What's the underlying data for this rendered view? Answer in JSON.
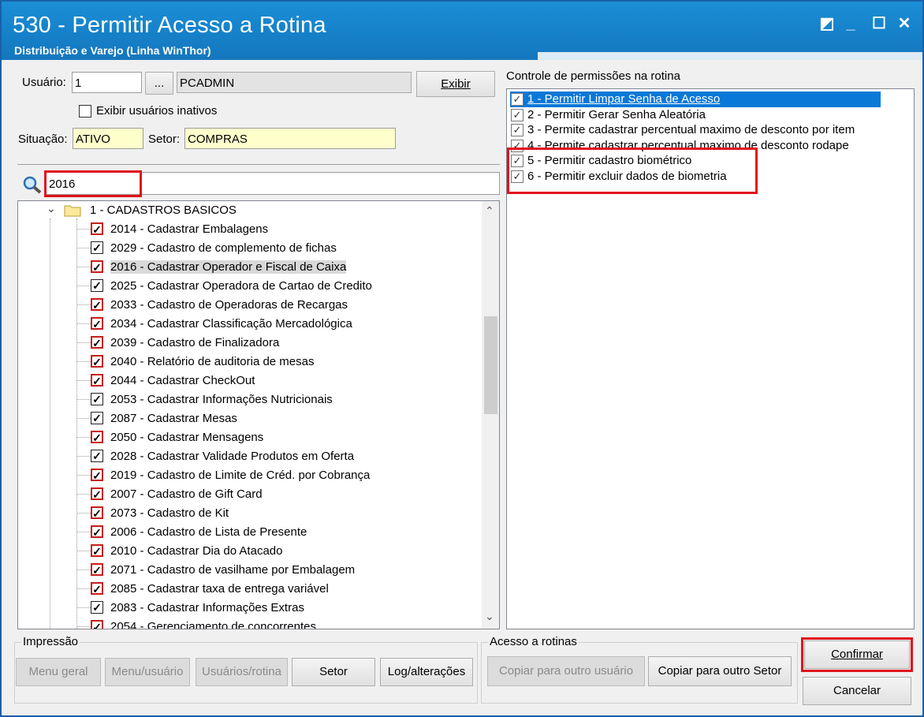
{
  "window": {
    "title": "530 - Permitir Acesso a Rotina",
    "subtitle": "Distribuição e Varejo (Linha WinThor)",
    "controls": [
      "◩",
      "_",
      "☐",
      "✕"
    ]
  },
  "user": {
    "usuario_label": "Usuário:",
    "usuario_value": "1",
    "browse_label": "...",
    "usuario_name": "PCADMIN",
    "exibir_label": "Exibir",
    "inativos_label": "Exibir usuários inativos",
    "situacao_label": "Situação:",
    "situacao_value": "ATIVO",
    "setor_label": "Setor:",
    "setor_value": "COMPRAS"
  },
  "search": {
    "value": "2016"
  },
  "tree": {
    "root_label": "1 - CADASTROS BASICOS",
    "items": [
      {
        "label": "2014 - Cadastrar Embalagens",
        "red": true
      },
      {
        "label": "2029 - Cadastro de complemento de fichas",
        "red": false
      },
      {
        "label": "2016 - Cadastrar Operador e Fiscal de Caixa",
        "red": true,
        "selected": true
      },
      {
        "label": "2025 - Cadastrar Operadora de Cartao de Credito",
        "red": false
      },
      {
        "label": "2033 - Cadastro de Operadoras de Recargas",
        "red": true
      },
      {
        "label": "2034 - Cadastrar Classificação Mercadológica",
        "red": true
      },
      {
        "label": "2039 - Cadastro de Finalizadora",
        "red": true
      },
      {
        "label": "2040 - Relatório de auditoria de mesas",
        "red": true
      },
      {
        "label": "2044 - Cadastrar CheckOut",
        "red": true
      },
      {
        "label": "2053 - Cadastrar Informações Nutricionais",
        "red": false
      },
      {
        "label": "2087 - Cadastrar Mesas",
        "red": false
      },
      {
        "label": "2050 - Cadastrar Mensagens",
        "red": true
      },
      {
        "label": "2028 - Cadastrar Validade Produtos em Oferta",
        "red": false
      },
      {
        "label": "2019 - Cadastro de Limite de Créd. por Cobrança",
        "red": true
      },
      {
        "label": "2007 - Cadastro de Gift Card",
        "red": true
      },
      {
        "label": "2073 - Cadastro de Kit",
        "red": true
      },
      {
        "label": "2006 - Cadastro de Lista de Presente",
        "red": true
      },
      {
        "label": "2010 - Cadastrar Dia do Atacado",
        "red": true
      },
      {
        "label": "2071 - Cadastro de vasilhame por Embalagem",
        "red": true
      },
      {
        "label": "2085 - Cadastrar taxa de entrega variável",
        "red": true
      },
      {
        "label": "2083 - Cadastrar Informações Extras",
        "red": false
      },
      {
        "label": "2054 - Gerenciamento de concorrentes",
        "red": true
      }
    ]
  },
  "permissions": {
    "title": "Controle de permissões na rotina",
    "items": [
      "1 - Permitir Limpar Senha de Acesso",
      "2 - Permitir Gerar Senha Aleatória",
      "3 - Permite cadastrar percentual maximo de desconto por item",
      "4 - Permite cadastrar percentual maximo de desconto rodape",
      "5 - Permitir cadastro biométrico",
      "6 - Permitir excluir dados de biometria"
    ]
  },
  "impressao": {
    "title": "Impressão",
    "buttons": [
      "Menu geral",
      "Menu/usuário",
      "Usuários/rotina",
      "Setor",
      "Log/alterações"
    ]
  },
  "acesso": {
    "title": "Acesso a rotinas",
    "buttons": [
      "Copiar para outro usuário",
      "Copiar para outro Setor"
    ]
  },
  "actions": {
    "confirm": "Confirmar",
    "cancel": "Cancelar"
  }
}
